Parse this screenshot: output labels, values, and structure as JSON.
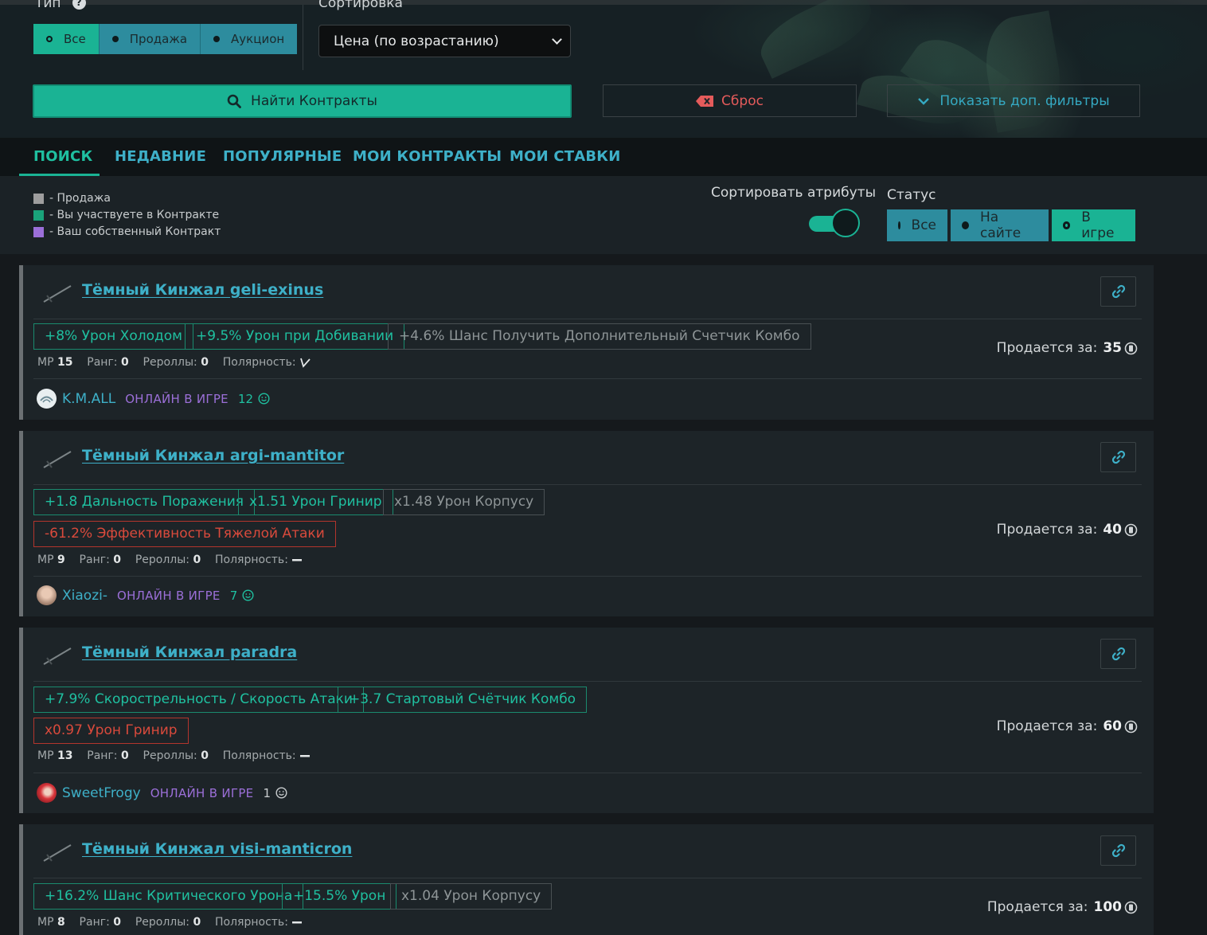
{
  "filters": {
    "type_label": "Тип",
    "type_options": [
      {
        "label": "Все",
        "selected": true
      },
      {
        "label": "Продажа",
        "selected": false
      },
      {
        "label": "Аукцион",
        "selected": false
      }
    ],
    "sort_label": "Сортировка",
    "sort_value": "Цена (по возрастанию)",
    "find_label": "Найти Контракты",
    "reset_label": "Сброс",
    "more_label": "Показать доп. фильтры"
  },
  "tabs": [
    {
      "label": "ПОИСК",
      "active": true
    },
    {
      "label": "НЕДАВНИЕ",
      "active": false
    },
    {
      "label": "ПОПУЛЯРНЫЕ",
      "active": false
    },
    {
      "label": "МОИ КОНТРАКТЫ",
      "active": false
    },
    {
      "label": "МОИ СТАВКИ",
      "active": false
    }
  ],
  "legend": [
    {
      "color": "#9e9e9e",
      "text": "- Продажа"
    },
    {
      "color": "#1aa37a",
      "text": "- Вы участвуете в Контракте"
    },
    {
      "color": "#9b6fd8",
      "text": "- Ваш собственный Контракт"
    }
  ],
  "sort_attributes": {
    "label": "Сортировать атрибуты",
    "enabled": true
  },
  "status": {
    "label": "Статус",
    "options": [
      {
        "label": "Все",
        "selected": false
      },
      {
        "label": "На сайте",
        "selected": false
      },
      {
        "label": "В игре",
        "selected": true
      }
    ]
  },
  "labels": {
    "mr": "MP",
    "rank": "Ранг:",
    "rerolls": "Рероллы:",
    "polarity": "Полярность:",
    "selling_for": "Продается за:"
  },
  "contracts": [
    {
      "title": "Тёмный Кинжал geli-exinus",
      "attributes_row1": [
        {
          "text": "+8% Урон Холодом",
          "kind": "pos"
        },
        {
          "text": "+9.5% Урон при Добивании",
          "kind": "pos"
        },
        {
          "text": "+4.6% Шанс Получить Дополнительный Счетчик Комбо",
          "kind": "neu"
        }
      ],
      "attributes_row2": [],
      "mr": "15",
      "rank": "0",
      "rerolls": "0",
      "polarity": "madurai",
      "user": "K.M.ALL",
      "user_status": "ОНЛАЙН В ИГРЕ",
      "reputation": "12",
      "price": "35"
    },
    {
      "title": "Тёмный Кинжал argi-mantitor",
      "attributes_row1": [
        {
          "text": "+1.8 Дальность Поражения",
          "kind": "pos"
        },
        {
          "text": "x1.51 Урон Гринир",
          "kind": "pos"
        },
        {
          "text": "x1.48 Урон Корпусу",
          "kind": "neu"
        }
      ],
      "attributes_row2": [
        {
          "text": "-61.2% Эффективность Тяжелой Атаки",
          "kind": "neg"
        }
      ],
      "mr": "9",
      "rank": "0",
      "rerolls": "0",
      "polarity": "naramon",
      "user": "Xiaozi-",
      "user_status": "ОНЛАЙН В ИГРЕ",
      "reputation": "7",
      "price": "40"
    },
    {
      "title": "Тёмный Кинжал paradra",
      "attributes_row1": [
        {
          "text": "+7.9% Скорострельность / Скорость Атаки",
          "kind": "pos"
        },
        {
          "text": "+3.7 Стартовый Счётчик Комбо",
          "kind": "pos"
        }
      ],
      "attributes_row2": [
        {
          "text": "x0.97 Урон Гринир",
          "kind": "neg"
        }
      ],
      "mr": "13",
      "rank": "0",
      "rerolls": "0",
      "polarity": "naramon",
      "user": "SweetFrogy",
      "user_status": "ОНЛАЙН В ИГРЕ",
      "reputation": "1",
      "price": "60"
    },
    {
      "title": "Тёмный Кинжал visi-manticron",
      "attributes_row1": [
        {
          "text": "+16.2% Шанс Критического Урона",
          "kind": "pos"
        },
        {
          "text": "+15.5% Урон",
          "kind": "pos"
        },
        {
          "text": "x1.04 Урон Корпусу",
          "kind": "neu"
        }
      ],
      "attributes_row2": [],
      "mr": "8",
      "rank": "0",
      "rerolls": "0",
      "polarity": "naramon",
      "user": "",
      "user_status": "",
      "reputation": "",
      "price": "100"
    }
  ]
}
